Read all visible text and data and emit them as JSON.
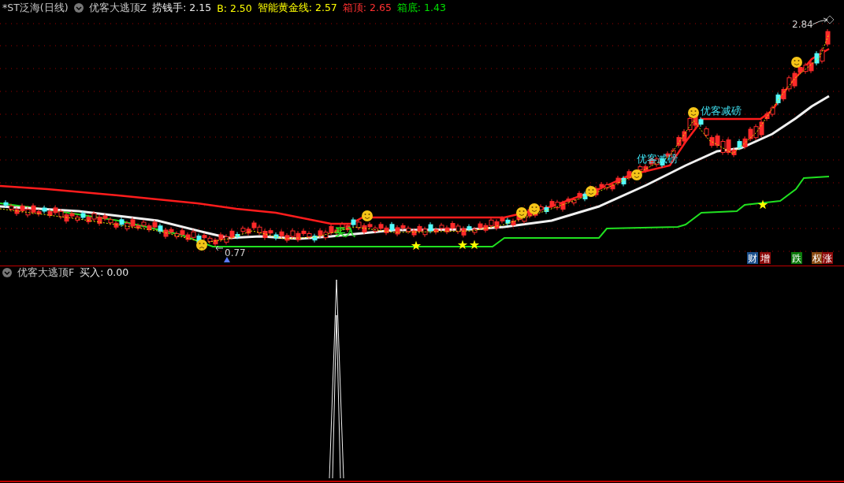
{
  "main_panel": {
    "title": "*ST泛海(日线)",
    "indicator": "优客大逃顶Z",
    "readings": [
      {
        "label": "捞钱手: 2.15",
        "color": "#e8e8e8"
      },
      {
        "label": "B: 2.50",
        "color": "#ffff00"
      },
      {
        "label": "智能黄金线: 2.57",
        "color": "#ffff00"
      },
      {
        "label": "箱顶: 2.65",
        "color": "#ff3030"
      },
      {
        "label": "箱底: 1.43",
        "color": "#00e000"
      }
    ],
    "price_labels": [
      "2.84",
      "0.77"
    ],
    "signals": [
      "优客减磅",
      "优客减磅"
    ],
    "buy_mark": "买入",
    "badges": [
      {
        "text": "财",
        "color": "#1c4f8c"
      },
      {
        "text": "增",
        "color": "#8c0a0a"
      },
      {
        "text": "跌",
        "color": "#0c7a0c"
      },
      {
        "text": "权",
        "color": "#8a4a12"
      },
      {
        "text": "涨",
        "color": "#8c0a0a"
      }
    ]
  },
  "sub_panel": {
    "indicator": "优客大逃顶F",
    "readings": [
      {
        "label": "买入: 0.00",
        "color": "#e8e8e8"
      }
    ]
  }
}
